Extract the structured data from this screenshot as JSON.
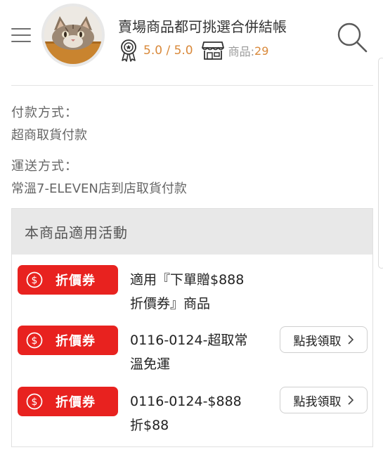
{
  "header": {
    "shop_name": "賣場商品都可挑選合併結帳",
    "rating": "5.0 / 5.0",
    "products_label": "商品:",
    "products_count": "29",
    "accent_color": "#d9893a"
  },
  "payment": {
    "label": "付款方式：",
    "value": "超商取貨付款"
  },
  "shipping": {
    "label": "運送方式：",
    "value": "常溫7-ELEVEN店到店取貨付款"
  },
  "promotions": {
    "title": "本商品適用活動",
    "badge_color": "#e8221f",
    "items": [
      {
        "badge": "折價券",
        "description": "適用『下單贈$888折價券』商品",
        "action": ""
      },
      {
        "badge": "折價券",
        "description": "0116-0124-超取常溫免運",
        "action": "點我領取"
      },
      {
        "badge": "折價券",
        "description": "0116-0124-$888折$88",
        "action": "點我領取"
      }
    ]
  }
}
